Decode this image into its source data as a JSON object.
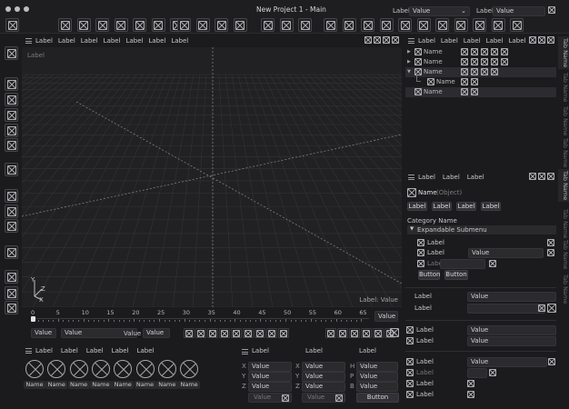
{
  "window": {
    "title": "New Project 1 - Main"
  },
  "header": {
    "field1_label": "Label:",
    "field1_value": "Value",
    "field2_label": "Label:",
    "field2_value": "Value"
  },
  "viewport": {
    "menu": [
      "Label",
      "Label",
      "Label",
      "Label",
      "Label",
      "Label",
      "Label"
    ],
    "corner_label": "Label",
    "status": "Label: Value",
    "axes": {
      "y": "Y",
      "z": "Z",
      "x": "X"
    },
    "timeline": {
      "ticks": [
        "0",
        "5",
        "10",
        "15",
        "20",
        "25",
        "30",
        "35",
        "40",
        "45",
        "50",
        "55",
        "60",
        "65"
      ],
      "end_value": "Value"
    },
    "controls": {
      "v1": "Value",
      "v2": "Value",
      "v3": "Value",
      "v4": "Value"
    }
  },
  "outliner": {
    "menu": [
      "Label",
      "Label",
      "Label",
      "Label",
      "Label"
    ],
    "items": [
      {
        "label": "Name",
        "expander": "▶"
      },
      {
        "label": "Name",
        "expander": "▶"
      },
      {
        "label": "Name",
        "expander": "▼"
      },
      {
        "label": "Name",
        "expander": ""
      },
      {
        "label": "Name",
        "expander": ""
      }
    ]
  },
  "side_tabs": [
    "Tab Name",
    "Tab Name",
    "Tab Name",
    "Tab Name",
    "Tab Name",
    "Tab Name",
    "Tab Name",
    "Tab Name"
  ],
  "properties": {
    "menu": [
      "Label",
      "Label",
      "Label"
    ],
    "object_name": "Name",
    "object_type": "(Object)",
    "tabs": [
      "Label",
      "Label",
      "Label",
      "Label"
    ],
    "category": "Category Name",
    "submenu": "Expandable Submenu",
    "sub_rows": [
      {
        "label": "Label"
      },
      {
        "label": "Label",
        "value": "Value"
      },
      {
        "label": "Label"
      }
    ],
    "buttons": [
      "Button",
      "Button"
    ],
    "group2": [
      {
        "label": "Label",
        "value": "Value"
      },
      {
        "label": "Label"
      }
    ],
    "group3": [
      {
        "label": "Label",
        "value": "Value"
      },
      {
        "label": "Label",
        "value": "Value"
      }
    ],
    "group4": [
      {
        "label": "Label",
        "value": "Value"
      },
      {
        "label": "Label"
      },
      {
        "label": "Label"
      },
      {
        "label": "Label"
      }
    ]
  },
  "assets": {
    "menu": [
      "Label",
      "Label",
      "Label",
      "Label",
      "Label"
    ],
    "items": [
      "Name",
      "Name",
      "Name",
      "Name",
      "Name",
      "Name",
      "Name",
      "Name"
    ]
  },
  "transform": {
    "cols": [
      "Label",
      "Label",
      "Label"
    ],
    "axes": [
      "X",
      "Y",
      "Z"
    ],
    "col3_axes": [
      "H",
      "P",
      "B"
    ],
    "values": "Value",
    "button": "Button"
  }
}
